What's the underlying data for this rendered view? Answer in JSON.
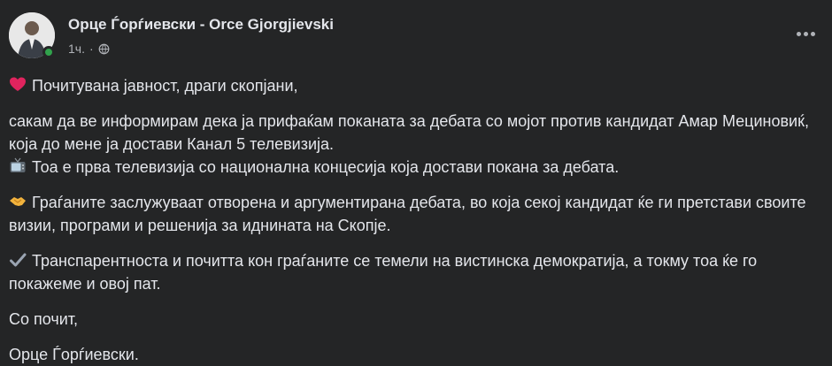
{
  "post": {
    "author": "Орце Ѓорѓиевски - Orce Gjorgjievski",
    "time": "1ч.",
    "separator": "·",
    "paragraphs": [
      {
        "emoji": "heart-icon",
        "text": "Почитувана јавност, драги скопјани,"
      },
      {
        "emoji": "",
        "text": "сакам да ве информирам дека ја прифаќам поканата за дебата со мојот против кандидат Амар Мециновиќ, која до мене ја достави Канал 5 телевизија."
      },
      {
        "emoji": "tv-icon",
        "text": "Тоа е прва телевизија со национална концесија која достави покана за дебата."
      },
      {
        "emoji": "handshake-icon",
        "text": "Граѓаните заслужуваат отворена и аргументирана дебата, во која секој кандидат ќе ги претстави своите визии, програми и решенија за иднината на Скопје."
      },
      {
        "emoji": "check-icon",
        "text": "Транспарентноста и почитта кон граѓаните се темели на вистинска демократија, а токму тоа ќе го покажеме и овој пат."
      },
      {
        "emoji": "",
        "text": "Со почит,"
      },
      {
        "emoji": "",
        "text": "Орце Ѓорѓиевски."
      }
    ]
  },
  "colors": {
    "background": "#242526",
    "text": "#e4e6eb",
    "secondary": "#b0b3b8",
    "online": "#31a24c"
  }
}
